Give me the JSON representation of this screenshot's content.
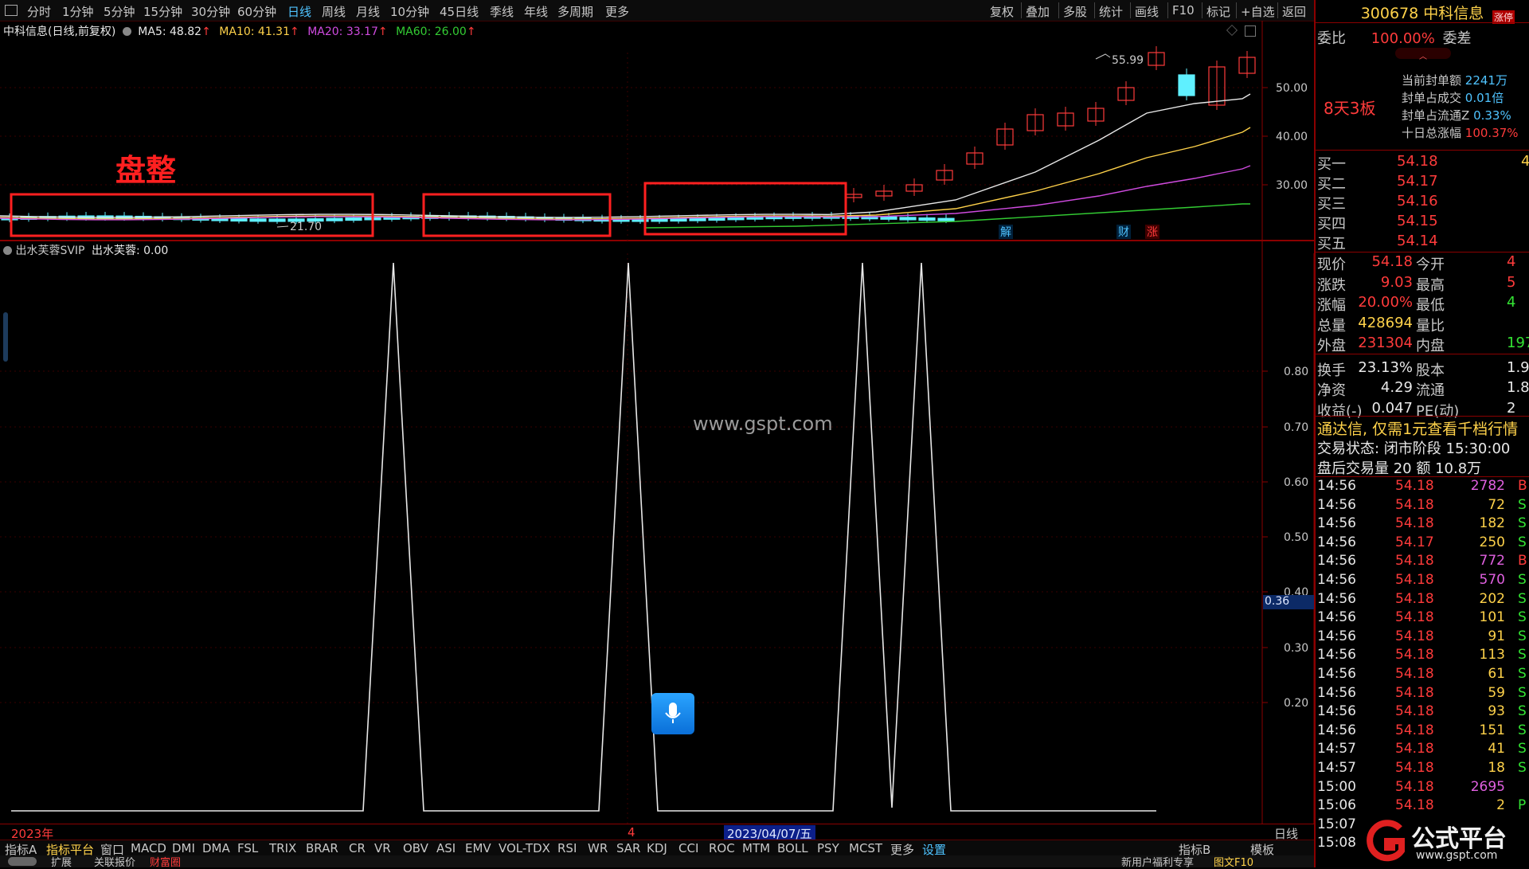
{
  "toolbar": {
    "left_icon": "window-icon",
    "periods": [
      "分时",
      "1分钟",
      "5分钟",
      "15分钟",
      "30分钟",
      "60分钟",
      "日线",
      "周线",
      "月线",
      "10分钟",
      "45日线",
      "季线",
      "年线",
      "多周期",
      "更多"
    ],
    "active_period": "日线",
    "right_actions": [
      "复权",
      "叠加",
      "多股",
      "统计",
      "画线",
      "F10",
      "标记",
      "+自选",
      "返回"
    ]
  },
  "main_chart": {
    "legend_title": "中科信息(日线,前复权)",
    "ma5": "MA5: 48.82",
    "ma10": "MA10: 41.31",
    "ma20": "MA20: 33.17",
    "ma60": "MA60: 26.00",
    "annotation": "盘整",
    "high_label": "55.99",
    "low_label": "21.70",
    "price_ticks": [
      "50.00",
      "40.00",
      "30.00"
    ],
    "markers": [
      "解",
      "财",
      "涨"
    ],
    "colors": {
      "ma5": "#e8e8e8",
      "ma10": "#ffd24a",
      "ma20": "#d04be0",
      "ma60": "#33cc33",
      "up": "#ff3b3b",
      "down": "#5ff0ff",
      "box": "#ff2020"
    }
  },
  "indicator": {
    "legend_name": "出水芙蓉SVIP",
    "legend_value": "出水芙蓉: 0.00",
    "ticks": [
      "0.80",
      "0.70",
      "0.60",
      "0.50",
      "0.40",
      "0.30",
      "0.20"
    ],
    "current_value": "0.36",
    "watermark": "www.gspt.com"
  },
  "date_axis": {
    "year_label": "2023年",
    "month_label": "4",
    "cursor_date": "2023/04/07/五",
    "period_label": "日线"
  },
  "bottom_tabs": [
    "指标A",
    "指标平台",
    "窗口",
    "MACD",
    "DMI",
    "DMA",
    "FSL",
    "TRIX",
    "BRAR",
    "CR",
    "VR",
    "OBV",
    "ASI",
    "EMV",
    "VOL-TDX",
    "RSI",
    "WR",
    "SAR",
    "KDJ",
    "CCI",
    "ROC",
    "MTM",
    "BOLL",
    "PSY",
    "MCST",
    "更多",
    "设置"
  ],
  "bottom_right_tabs": [
    "指标B",
    "模板"
  ],
  "bottom_strip": [
    "扩展",
    "关联报价",
    "财富圈",
    "新用户福利专享",
    "图文F10"
  ],
  "right_panel": {
    "code": "300678",
    "name": "中科信息",
    "badge": "涨停",
    "weibi_label": "委比",
    "weibi_value": "100.00%",
    "weicha_label": "委差",
    "streak": "8天3板",
    "seal_stats": [
      {
        "label": "当前封单额",
        "value": "2241万"
      },
      {
        "label": "封单占成交",
        "value": "0.01倍"
      },
      {
        "label": "封单占流通Z",
        "value": "0.33%"
      },
      {
        "label": "十日总涨幅",
        "value": "100.37%"
      }
    ],
    "bids": [
      {
        "label": "买一",
        "price": "54.18",
        "vol": "4"
      },
      {
        "label": "买二",
        "price": "54.17",
        "vol": ""
      },
      {
        "label": "买三",
        "price": "54.16",
        "vol": ""
      },
      {
        "label": "买四",
        "price": "54.15",
        "vol": ""
      },
      {
        "label": "买五",
        "price": "54.14",
        "vol": ""
      }
    ],
    "quote_left": [
      {
        "label": "现价",
        "value": "54.18"
      },
      {
        "label": "涨跌",
        "value": "9.03"
      },
      {
        "label": "涨幅",
        "value": "20.00%"
      },
      {
        "label": "总量",
        "value": "428694"
      },
      {
        "label": "外盘",
        "value": "231304"
      },
      {
        "label": "换手",
        "value": "23.13%"
      },
      {
        "label": "净资",
        "value": "4.29"
      },
      {
        "label": "收益(-)",
        "value": "0.047"
      }
    ],
    "quote_right": [
      {
        "label": "今开",
        "value": "4"
      },
      {
        "label": "最高",
        "value": "5"
      },
      {
        "label": "最低",
        "value": "4"
      },
      {
        "label": "量比",
        "value": ""
      },
      {
        "label": "内盘",
        "value": "197"
      },
      {
        "label": "股本",
        "value": "1.9"
      },
      {
        "label": "流通",
        "value": "1.8"
      },
      {
        "label": "PE(动)",
        "value": "2"
      }
    ],
    "promo": "通达信, 仅需1元查看千档行情",
    "status_line": "交易状态: 闭市阶段 15:30:00",
    "after_hours": "盘后交易量 20 额 10.8万",
    "trades": [
      {
        "t": "14:56",
        "p": "54.18",
        "v": "2782",
        "s": "B"
      },
      {
        "t": "14:56",
        "p": "54.18",
        "v": "72",
        "s": "S"
      },
      {
        "t": "14:56",
        "p": "54.18",
        "v": "182",
        "s": "S"
      },
      {
        "t": "14:56",
        "p": "54.17",
        "v": "250",
        "s": "S"
      },
      {
        "t": "14:56",
        "p": "54.18",
        "v": "772",
        "s": "B"
      },
      {
        "t": "14:56",
        "p": "54.18",
        "v": "570",
        "s": "S"
      },
      {
        "t": "14:56",
        "p": "54.18",
        "v": "202",
        "s": "S"
      },
      {
        "t": "14:56",
        "p": "54.18",
        "v": "101",
        "s": "S"
      },
      {
        "t": "14:56",
        "p": "54.18",
        "v": "91",
        "s": "S"
      },
      {
        "t": "14:56",
        "p": "54.18",
        "v": "113",
        "s": "S"
      },
      {
        "t": "14:56",
        "p": "54.18",
        "v": "61",
        "s": "S"
      },
      {
        "t": "14:56",
        "p": "54.18",
        "v": "59",
        "s": "S"
      },
      {
        "t": "14:56",
        "p": "54.18",
        "v": "93",
        "s": "S"
      },
      {
        "t": "14:56",
        "p": "54.18",
        "v": "151",
        "s": "S"
      },
      {
        "t": "14:57",
        "p": "54.18",
        "v": "41",
        "s": "S"
      },
      {
        "t": "14:57",
        "p": "54.18",
        "v": "18",
        "s": "S"
      },
      {
        "t": "15:00",
        "p": "54.18",
        "v": "2695",
        "s": ""
      },
      {
        "t": "15:06",
        "p": "54.18",
        "v": "2",
        "s": "P"
      },
      {
        "t": "15:07",
        "p": "",
        "v": "",
        "s": ""
      },
      {
        "t": "15:08",
        "p": "",
        "v": "",
        "s": ""
      }
    ],
    "logo_text": "公式平台",
    "logo_url": "www.gspt.com"
  },
  "mic_button": "microphone-icon"
}
